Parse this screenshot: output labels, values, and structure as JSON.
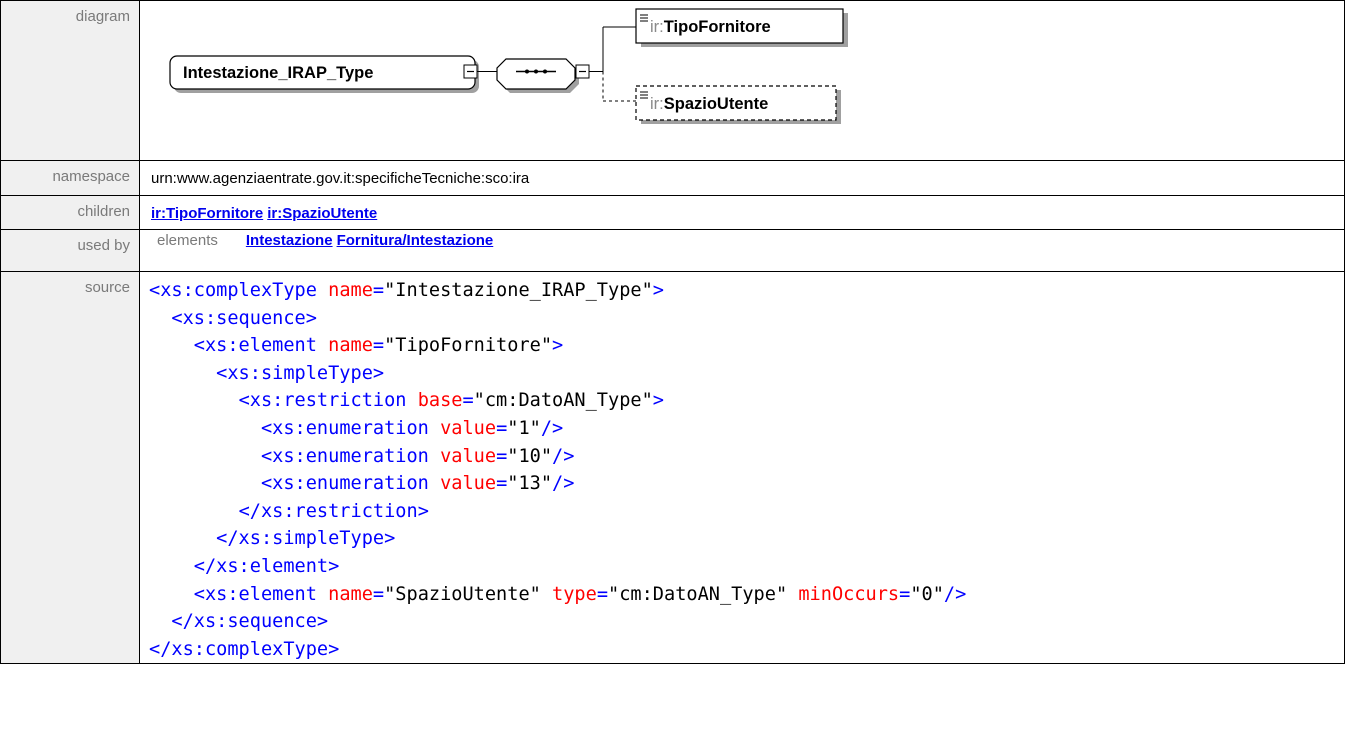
{
  "labels": {
    "diagram": "diagram",
    "namespace": "namespace",
    "children": "children",
    "used_by": "used by",
    "source": "source"
  },
  "diagram": {
    "root": "Intestazione_IRAP_Type",
    "children": [
      {
        "prefix": "ir:",
        "name": "TipoFornitore",
        "optional": false
      },
      {
        "prefix": "ir:",
        "name": "SpazioUtente",
        "optional": true
      }
    ]
  },
  "namespace": "urn:www.agenziaentrate.gov.it:specificheTecniche:sco:ira",
  "children_links": [
    "ir:TipoFornitore",
    "ir:SpazioUtente"
  ],
  "used_by": {
    "kind": "elements",
    "links": [
      "Intestazione",
      "Fornitura/Intestazione"
    ]
  },
  "source_lines": [
    {
      "indent": 0,
      "tag": "<xs:complexType",
      "attrs": [
        {
          "n": "name",
          "v": "Intestazione_IRAP_Type"
        }
      ],
      "end": ">"
    },
    {
      "indent": 1,
      "tag": "<xs:sequence",
      "attrs": [],
      "end": ">"
    },
    {
      "indent": 2,
      "tag": "<xs:element",
      "attrs": [
        {
          "n": "name",
          "v": "TipoFornitore"
        }
      ],
      "end": ">"
    },
    {
      "indent": 3,
      "tag": "<xs:simpleType",
      "attrs": [],
      "end": ">"
    },
    {
      "indent": 4,
      "tag": "<xs:restriction",
      "attrs": [
        {
          "n": "base",
          "v": "cm:DatoAN_Type"
        }
      ],
      "end": ">"
    },
    {
      "indent": 5,
      "tag": "<xs:enumeration",
      "attrs": [
        {
          "n": "value",
          "v": "1"
        }
      ],
      "end": "/>"
    },
    {
      "indent": 5,
      "tag": "<xs:enumeration",
      "attrs": [
        {
          "n": "value",
          "v": "10"
        }
      ],
      "end": "/>"
    },
    {
      "indent": 5,
      "tag": "<xs:enumeration",
      "attrs": [
        {
          "n": "value",
          "v": "13"
        }
      ],
      "end": "/>"
    },
    {
      "indent": 4,
      "tag": "</xs:restriction",
      "attrs": [],
      "end": ">"
    },
    {
      "indent": 3,
      "tag": "</xs:simpleType",
      "attrs": [],
      "end": ">"
    },
    {
      "indent": 2,
      "tag": "</xs:element",
      "attrs": [],
      "end": ">"
    },
    {
      "indent": 2,
      "tag": "<xs:element",
      "attrs": [
        {
          "n": "name",
          "v": "SpazioUtente"
        },
        {
          "n": "type",
          "v": "cm:DatoAN_Type"
        },
        {
          "n": "minOccurs",
          "v": "0"
        }
      ],
      "end": "/>"
    },
    {
      "indent": 1,
      "tag": "</xs:sequence",
      "attrs": [],
      "end": ">"
    },
    {
      "indent": 0,
      "tag": "</xs:complexType",
      "attrs": [],
      "end": ">"
    }
  ]
}
